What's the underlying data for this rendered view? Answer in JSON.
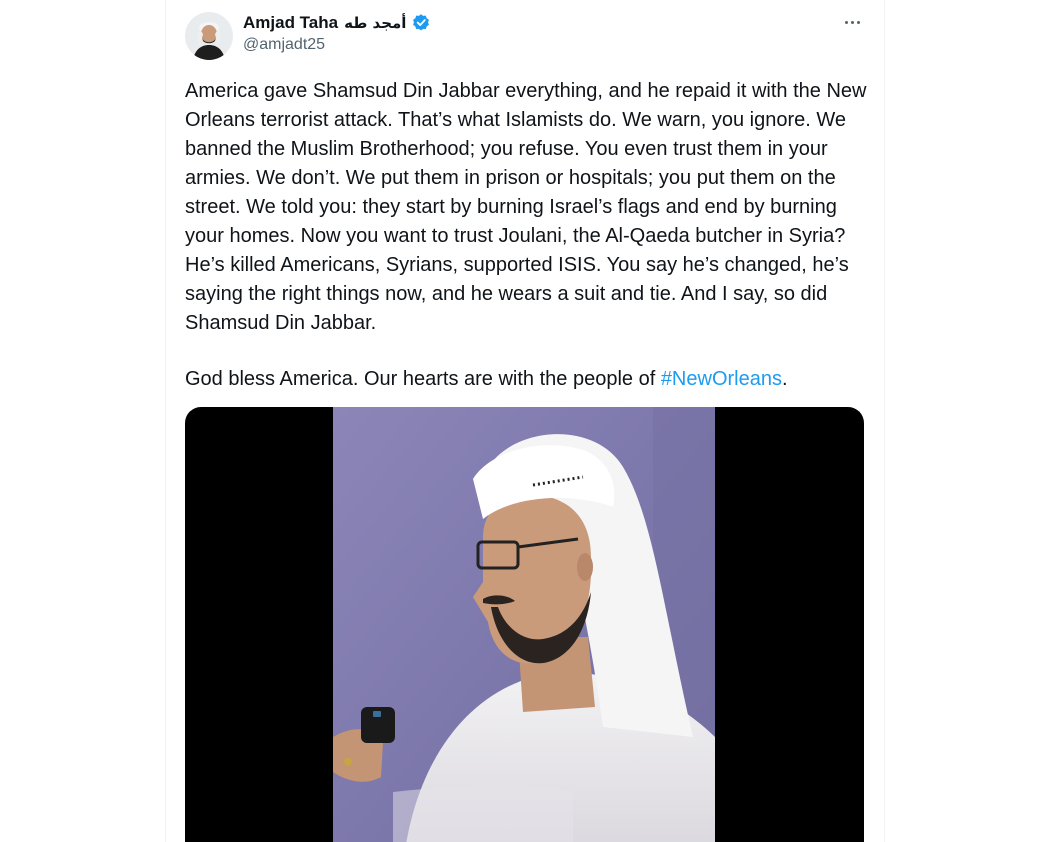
{
  "author": {
    "display_name": "Amjad Taha",
    "arabic_name": "أمجد طه",
    "handle": "@amjadt25",
    "verified_icon": "verified-badge-icon"
  },
  "tweet": {
    "body": "America gave Shamsud Din Jabbar everything, and he repaid it with the New Orleans terrorist attack. That’s what Islamists do. We warn, you ignore. We banned the Muslim Brotherhood; you refuse. You even trust them in your armies. We don’t. We put them in prison or hospitals; you put them on the street. We told you: they start by burning Israel’s flags and end by burning your homes. Now you want to trust Joulani, the Al-Qaeda butcher in Syria? He’s killed Americans, Syrians, supported ISIS. You say he’s changed, he’s saying the right things now, and he wears a suit and tie. And I say, so did Shamsud Din Jabbar.",
    "closing_text": "God bless America. Our hearts are with the people of ",
    "hashtag": "#NewOrleans",
    "closing_punct": "."
  },
  "colors": {
    "text": "#0f1419",
    "secondary": "#536471",
    "accent": "#1d9bf0",
    "border": "#eff3f4"
  }
}
